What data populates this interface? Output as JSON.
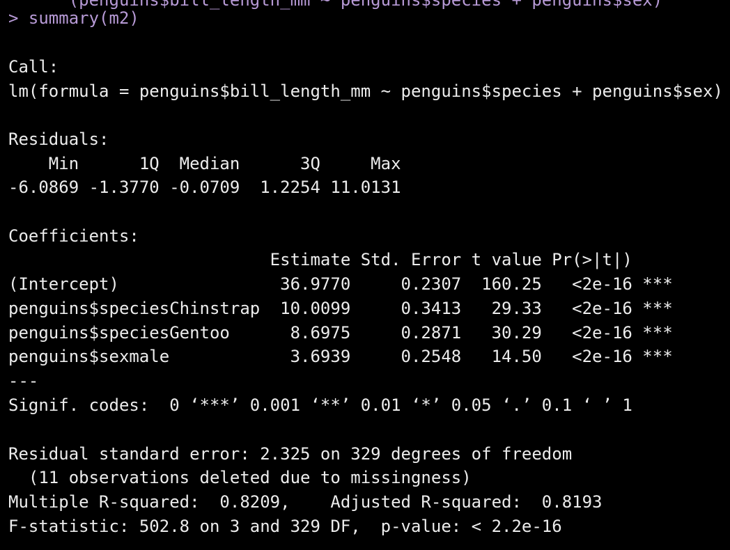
{
  "terminal": {
    "clipped_previous_line": "      (penguins$bill_length_mm ~ penguins$species + penguins$sex)",
    "prompt": ">",
    "command": "summary(m2)",
    "call_header": "Call:",
    "call_formula": "lm(formula = penguins$bill_length_mm ~ penguins$species + penguins$sex)",
    "residuals_header": "Residuals:",
    "residuals_columns": "    Min      1Q  Median      3Q     Max ",
    "residuals_values": "-6.0869 -1.3770 -0.0709  1.2254 11.0131 ",
    "coefficients_header": "Coefficients:",
    "coef_columns": "                          Estimate Std. Error t value Pr(>|t|)    ",
    "coef_rows": [
      "(Intercept)                36.9770     0.2307  160.25   <2e-16 ***",
      "penguins$speciesChinstrap  10.0099     0.3413   29.33   <2e-16 ***",
      "penguins$speciesGentoo      8.6975     0.2871   30.29   <2e-16 ***",
      "penguins$sexmale            3.6939     0.2548   14.50   <2e-16 ***"
    ],
    "separator": "---",
    "signif_codes": "Signif. codes:  0 ‘***’ 0.001 ‘**’ 0.01 ‘*’ 0.05 ‘.’ 0.1 ‘ ’ 1",
    "rse": "Residual standard error: 2.325 on 329 degrees of freedom",
    "missing": "  (11 observations deleted due to missingness)",
    "r_squared": "Multiple R-squared:  0.8209,\tAdjusted R-squared:  0.8193 ",
    "f_statistic": "F-statistic: 502.8 on 3 and 329 DF,  p-value: < 2.2e-16"
  }
}
